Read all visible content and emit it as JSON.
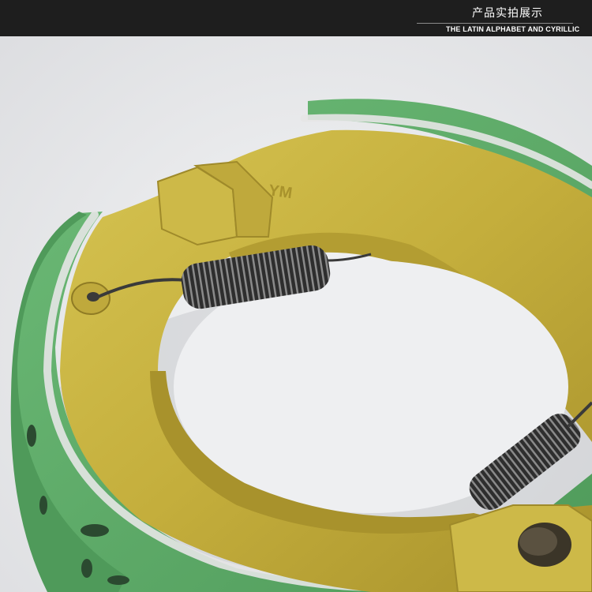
{
  "header": {
    "title": "产品实拍展示",
    "subtitle": "THE LATIN ALPHABET AND CYRILLIC"
  },
  "photo": {
    "embossed_mark": "YM",
    "colors": {
      "background": "#e9eaec",
      "header_band": "#1e1e1e",
      "lining_green": "#5fae6a",
      "shoe_gold": "#c4ae3c",
      "spring_metal": "#3a3a3a"
    }
  }
}
